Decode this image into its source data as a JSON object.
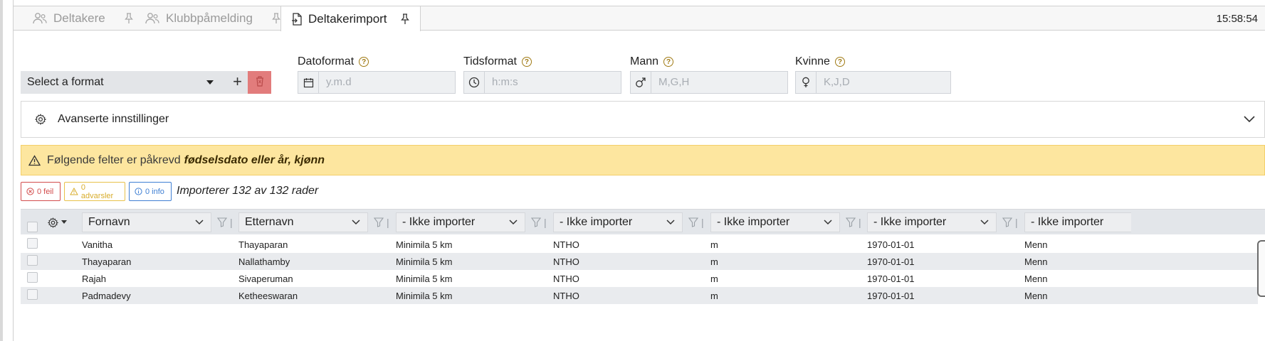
{
  "tabs": [
    {
      "label": "Deltakere",
      "active": false
    },
    {
      "label": "Klubbpåmelding",
      "active": false
    },
    {
      "label": "Deltakerimport",
      "active": true
    }
  ],
  "clock": "15:58:54",
  "format": {
    "select_label": "Select a format",
    "add_label": "+"
  },
  "fields": {
    "date": {
      "label": "Datoformat",
      "placeholder": "y.m.d",
      "icon": "calendar-icon"
    },
    "time": {
      "label": "Tidsformat",
      "placeholder": "h:m:s",
      "icon": "clock-icon"
    },
    "male": {
      "label": "Mann",
      "placeholder": "M,G,H",
      "icon": "male-icon"
    },
    "female": {
      "label": "Kvinne",
      "placeholder": "K,J,D",
      "icon": "female-icon"
    }
  },
  "advanced": {
    "label": "Avanserte innstillinger"
  },
  "warning": {
    "text": "Følgende felter er påkrevd",
    "fields": "fødselsdato eller år, kjønn"
  },
  "badges": {
    "errors": "0 feil",
    "warnings": "0 advarsler",
    "info": "0 info"
  },
  "import_status": "Importerer 132 av 132 rader",
  "columns": [
    "Fornavn",
    "Etternavn",
    "- Ikke importer",
    "- Ikke importer",
    "- Ikke importer",
    "- Ikke importer",
    "- Ikke importer"
  ],
  "rows": [
    [
      "Vanitha",
      "Thayaparan",
      "Minimila 5 km",
      "NTHO",
      "m",
      "1970-01-01",
      "Menn"
    ],
    [
      "Thayaparan",
      "Nallathamby",
      "Minimila 5 km",
      "NTHO",
      "m",
      "1970-01-01",
      "Menn"
    ],
    [
      "Rajah",
      "Sivaperuman",
      "Minimila 5 km",
      "NTHO",
      "m",
      "1970-01-01",
      "Menn"
    ],
    [
      "Padmadevy",
      "Ketheeswaran",
      "Minimila 5 km",
      "NTHO",
      "m",
      "1970-01-01",
      "Menn"
    ]
  ],
  "colors": {
    "warning_bg": "#fde69f",
    "delete_bg": "#e27c7c",
    "error": "#d24b4b",
    "info": "#3f7fd3",
    "warning": "#e8c14a"
  }
}
